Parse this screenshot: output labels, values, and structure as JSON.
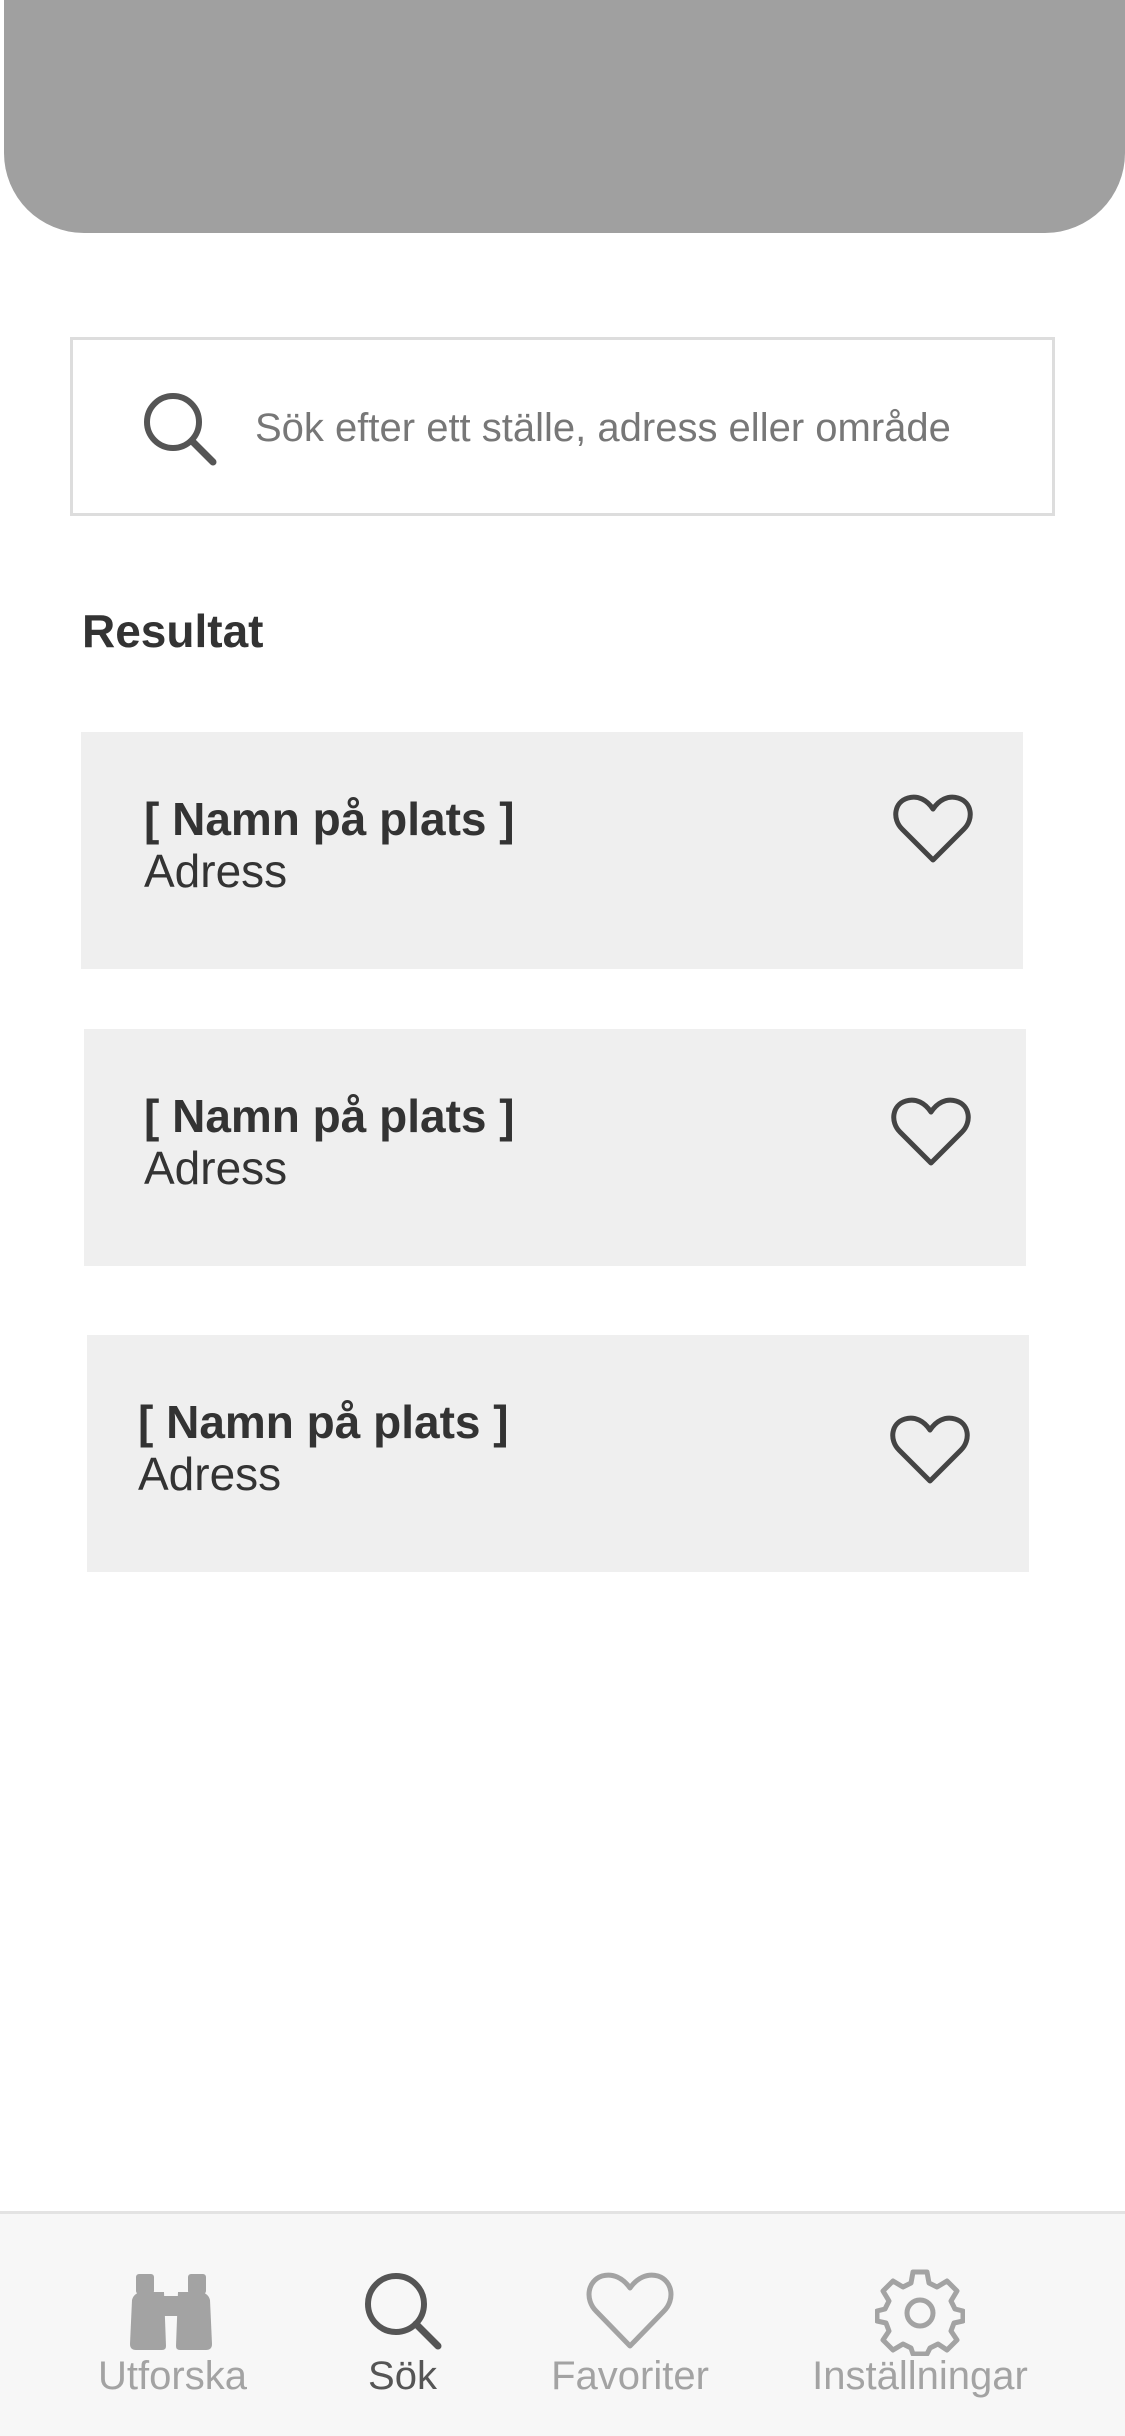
{
  "search": {
    "placeholder": "Sök efter ett ställe, adress eller område"
  },
  "results": {
    "title": "Resultat",
    "items": [
      {
        "name": "[ Namn på plats ]",
        "address": "Adress",
        "favorite_icon": "heart-outline-icon"
      },
      {
        "name": "[ Namn på plats ]",
        "address": "Adress",
        "favorite_icon": "heart-outline-icon"
      },
      {
        "name": "[ Namn på plats ]",
        "address": "Adress",
        "favorite_icon": "heart-outline-icon"
      }
    ]
  },
  "tabbar": {
    "items": [
      {
        "label": "Utforska",
        "icon": "binoculars-icon",
        "active": false
      },
      {
        "label": "Sök",
        "icon": "search-icon",
        "active": true
      },
      {
        "label": "Favoriter",
        "icon": "heart-icon",
        "active": false
      },
      {
        "label": "Inställningar",
        "icon": "gear-icon",
        "active": false
      }
    ]
  },
  "colors": {
    "header_banner": "#a0a0a0",
    "card_background": "#efefef",
    "text_primary": "#333333",
    "tab_inactive": "#a3a3a3",
    "tab_active": "#555555",
    "tabbar_background": "#f7f7f7"
  }
}
